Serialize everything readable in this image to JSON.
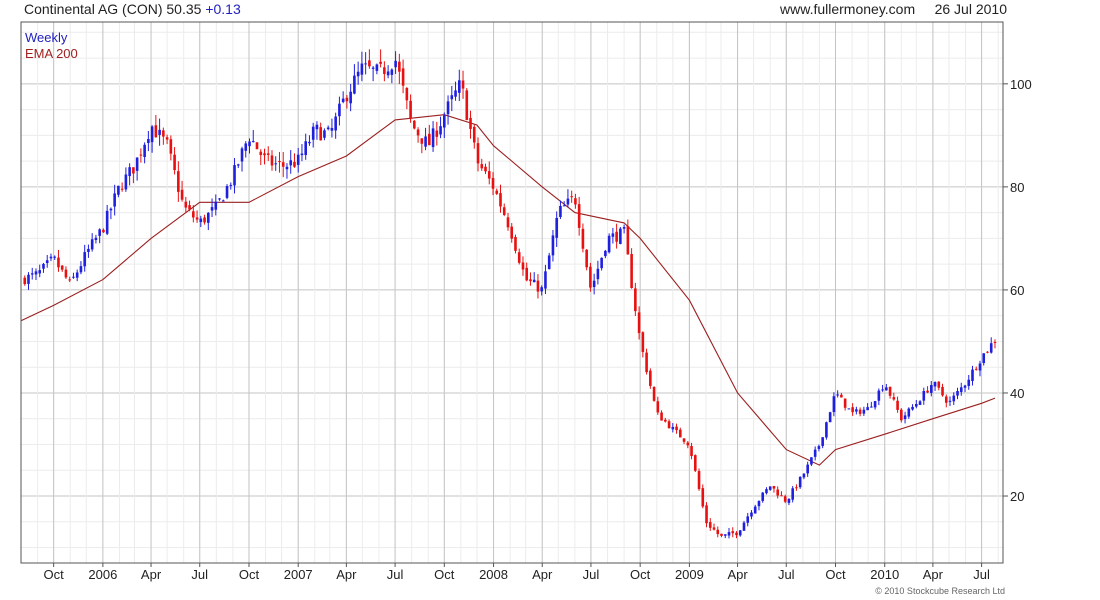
{
  "header": {
    "name": "Continental AG (CON)",
    "price": "50.35",
    "change": "+0.13",
    "site": "www.fullermoney.com",
    "date": "26 Jul 2010"
  },
  "legend": {
    "weekly": "Weekly",
    "ema": "EMA 200"
  },
  "copyright": "© 2010 Stockcube Research Ltd",
  "colors": {
    "up": "#1f1fdf",
    "down": "#e81010",
    "ema": "#9b2020",
    "grid": "#d4d4d4"
  },
  "chart_data": {
    "type": "candlestick",
    "title": "Continental AG (CON)",
    "x_tick_labels": [
      "Oct",
      "2006",
      "Apr",
      "Jul",
      "Oct",
      "2007",
      "Apr",
      "Jul",
      "Oct",
      "2008",
      "Apr",
      "Jul",
      "Oct",
      "2009",
      "Apr",
      "Jul",
      "Oct",
      "2010",
      "Apr",
      "Jul"
    ],
    "x_tick_dates": [
      "2005-10-01",
      "2006-01-01",
      "2006-04-01",
      "2006-07-01",
      "2006-10-01",
      "2007-01-01",
      "2007-04-01",
      "2007-07-01",
      "2007-10-01",
      "2008-01-01",
      "2008-04-01",
      "2008-07-01",
      "2008-10-01",
      "2009-01-01",
      "2009-04-01",
      "2009-07-01",
      "2009-10-01",
      "2010-01-01",
      "2010-04-01",
      "2010-07-01"
    ],
    "y_ticks": [
      20,
      40,
      60,
      80,
      100
    ],
    "ylim": [
      7,
      112
    ],
    "xlim": [
      "2005-08-01",
      "2010-08-10"
    ],
    "grid": true,
    "legend_position": "top-left",
    "price_path": [
      [
        "2005-08-01",
        62
      ],
      [
        "2005-09-01",
        63
      ],
      [
        "2005-10-01",
        66
      ],
      [
        "2005-11-01",
        61
      ],
      [
        "2005-12-01",
        67
      ],
      [
        "2006-01-01",
        72
      ],
      [
        "2006-02-01",
        80
      ],
      [
        "2006-03-01",
        84
      ],
      [
        "2006-04-01",
        92
      ],
      [
        "2006-05-01",
        88
      ],
      [
        "2006-06-01",
        76
      ],
      [
        "2006-07-01",
        73
      ],
      [
        "2006-08-01",
        76
      ],
      [
        "2006-09-01",
        82
      ],
      [
        "2006-10-01",
        90
      ],
      [
        "2006-11-01",
        85
      ],
      [
        "2006-12-01",
        84
      ],
      [
        "2007-01-01",
        85
      ],
      [
        "2007-02-01",
        91
      ],
      [
        "2007-03-01",
        90
      ],
      [
        "2007-04-01",
        98
      ],
      [
        "2007-05-01",
        103
      ],
      [
        "2007-06-01",
        102
      ],
      [
        "2007-07-01",
        105
      ],
      [
        "2007-08-01",
        92
      ],
      [
        "2007-09-01",
        88
      ],
      [
        "2007-10-01",
        94
      ],
      [
        "2007-11-01",
        100
      ],
      [
        "2007-12-01",
        85
      ],
      [
        "2008-01-01",
        80
      ],
      [
        "2008-02-01",
        72
      ],
      [
        "2008-03-01",
        62
      ],
      [
        "2008-04-01",
        60
      ],
      [
        "2008-05-01",
        75
      ],
      [
        "2008-06-01",
        78
      ],
      [
        "2008-07-01",
        60
      ],
      [
        "2008-08-01",
        70
      ],
      [
        "2008-09-01",
        71
      ],
      [
        "2008-10-01",
        50
      ],
      [
        "2008-11-01",
        36
      ],
      [
        "2008-12-01",
        33
      ],
      [
        "2009-01-01",
        30
      ],
      [
        "2009-02-01",
        15
      ],
      [
        "2009-03-01",
        12
      ],
      [
        "2009-04-01",
        13
      ],
      [
        "2009-05-01",
        18
      ],
      [
        "2009-06-01",
        22
      ],
      [
        "2009-07-01",
        19
      ],
      [
        "2009-08-01",
        24
      ],
      [
        "2009-09-01",
        30
      ],
      [
        "2009-10-01",
        40
      ],
      [
        "2009-11-01",
        36
      ],
      [
        "2009-12-01",
        37
      ],
      [
        "2010-01-01",
        42
      ],
      [
        "2010-02-01",
        35
      ],
      [
        "2010-03-01",
        38
      ],
      [
        "2010-04-01",
        42
      ],
      [
        "2010-05-01",
        38
      ],
      [
        "2010-06-01",
        42
      ],
      [
        "2010-07-01",
        47
      ],
      [
        "2010-07-26",
        50.35
      ]
    ],
    "ema_200": [
      [
        "2005-08-01",
        54
      ],
      [
        "2005-10-01",
        57
      ],
      [
        "2006-01-01",
        62
      ],
      [
        "2006-04-01",
        70
      ],
      [
        "2006-07-01",
        77
      ],
      [
        "2006-10-01",
        77
      ],
      [
        "2007-01-01",
        82
      ],
      [
        "2007-04-01",
        86
      ],
      [
        "2007-07-01",
        93
      ],
      [
        "2007-10-01",
        94
      ],
      [
        "2007-12-01",
        92
      ],
      [
        "2008-01-01",
        88
      ],
      [
        "2008-04-01",
        80
      ],
      [
        "2008-06-01",
        75
      ],
      [
        "2008-09-01",
        73
      ],
      [
        "2008-10-01",
        70
      ],
      [
        "2009-01-01",
        58
      ],
      [
        "2009-04-01",
        40
      ],
      [
        "2009-07-01",
        29
      ],
      [
        "2009-09-01",
        26
      ],
      [
        "2009-10-01",
        29
      ],
      [
        "2010-01-01",
        32
      ],
      [
        "2010-04-01",
        35
      ],
      [
        "2010-07-01",
        38
      ],
      [
        "2010-07-26",
        39
      ]
    ]
  }
}
